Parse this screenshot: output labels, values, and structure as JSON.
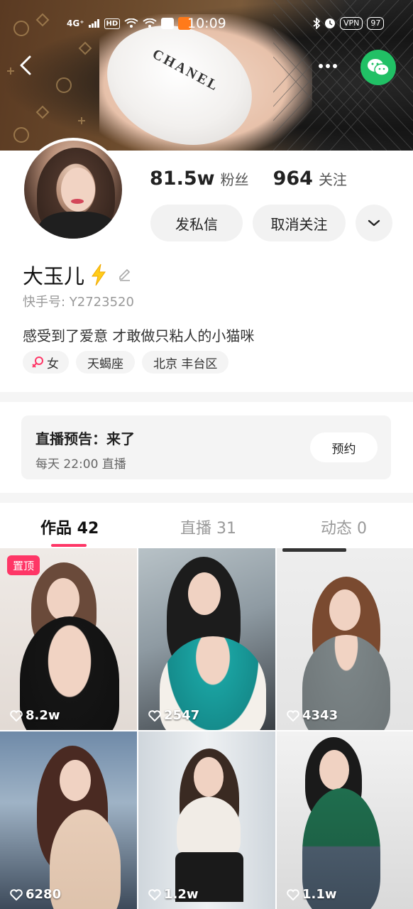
{
  "status_bar": {
    "network": "4G⁺",
    "hd": "HD",
    "time": "10:09",
    "vpn": "VPN",
    "battery": "97"
  },
  "banner": {
    "brand_text": "CHANEL"
  },
  "profile": {
    "followers_count": "81.5w",
    "followers_label": "粉丝",
    "following_count": "964",
    "following_label": "关注",
    "message_button": "发私信",
    "unfollow_button": "取消关注",
    "name": "大玉儿",
    "user_id": "快手号: Y2723520",
    "bio": "感受到了爱意 才敢做只粘人的小猫咪",
    "tags": {
      "gender": "女",
      "zodiac": "天蝎座",
      "location": "北京 丰台区"
    }
  },
  "live_preview": {
    "title": "直播预告：来了",
    "schedule": "每天 22:00 直播",
    "reserve_button": "预约"
  },
  "tabs": [
    {
      "label": "作品 42"
    },
    {
      "label": "直播 31"
    },
    {
      "label": "动态 0"
    }
  ],
  "videos": [
    {
      "likes": "8.2w",
      "badge": "置顶"
    },
    {
      "likes": "2547"
    },
    {
      "likes": "4343"
    },
    {
      "likes": "6280"
    },
    {
      "likes": "1.2w"
    },
    {
      "likes": "1.1w"
    }
  ],
  "colors": {
    "accent": "#fe3666",
    "wechat": "#21c065"
  }
}
